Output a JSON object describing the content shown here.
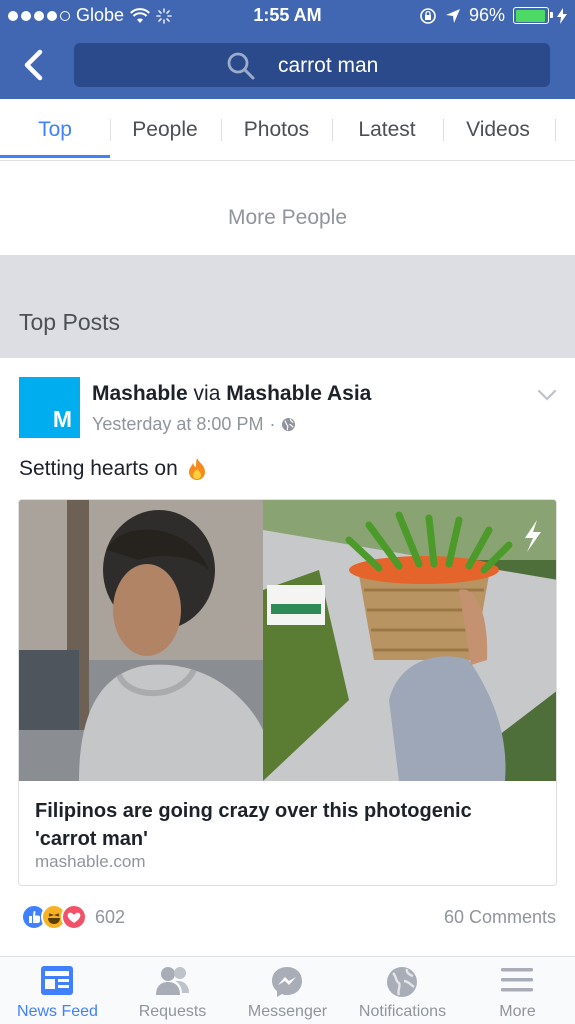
{
  "status_bar": {
    "carrier": "Globe",
    "time": "1:55 AM",
    "battery": "96%",
    "battery_level": 0.96
  },
  "search": {
    "query": "carrot man"
  },
  "tabs": [
    {
      "label": "Top",
      "active": true
    },
    {
      "label": "People"
    },
    {
      "label": "Photos"
    },
    {
      "label": "Latest"
    },
    {
      "label": "Videos"
    }
  ],
  "more_people": "More People",
  "section_title": "Top Posts",
  "post": {
    "avatar_letter": "M",
    "author": "Mashable",
    "via": "via",
    "page": "Mashable Asia",
    "time": "Yesterday at 8:00 PM",
    "separator": "·",
    "text": "Setting hearts on",
    "link": {
      "title": "Filipinos are going crazy over this photogenic 'carrot man'",
      "domain": "mashable.com"
    },
    "reaction_count": "602",
    "comments": "60 Comments"
  },
  "bottom_nav": [
    {
      "label": "News Feed",
      "icon": "news-feed-icon",
      "active": true
    },
    {
      "label": "Requests",
      "icon": "friend-requests-icon"
    },
    {
      "label": "Messenger",
      "icon": "messenger-icon"
    },
    {
      "label": "Notifications",
      "icon": "globe-icon"
    },
    {
      "label": "More",
      "icon": "menu-icon"
    }
  ],
  "colors": {
    "brand": "#4267b2",
    "accent": "#4080ff",
    "avatar": "#00aeef"
  }
}
